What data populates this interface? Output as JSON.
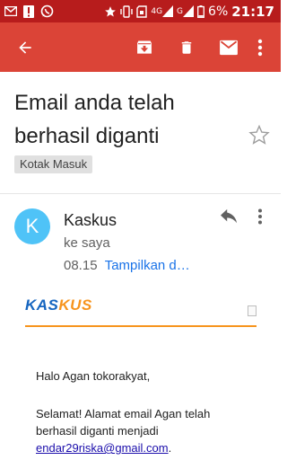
{
  "status_bar": {
    "network_label": "4G",
    "signal_label": "G",
    "battery_percent": "6%",
    "time": "21:17",
    "left_icons": [
      "gmail-icon",
      "alert-icon",
      "whatsapp-icon"
    ],
    "right_icons": [
      "star-icon",
      "vibrate-icon",
      "sim-icon",
      "signal-4g-icon",
      "signal-g-icon",
      "battery-icon"
    ]
  },
  "toolbar": {
    "color": "#db4437",
    "status_color": "#b71c1c",
    "icons": [
      "back-arrow-icon",
      "archive-icon",
      "delete-icon",
      "mark-unread-icon",
      "more-vert-icon"
    ]
  },
  "message": {
    "subject": "Email anda telah berhasil diganti",
    "label": "Kotak Masuk",
    "sender_initial": "K",
    "sender_name": "Kaskus",
    "recipient": "ke saya",
    "time": "08.15",
    "details_link": "Tampilkan d…",
    "avatar_color": "#4fc3f7"
  },
  "email_body": {
    "logo_part1": "KAS",
    "logo_part2": "KUS",
    "greeting": "Halo Agan tokorakyat,",
    "paragraph": "Selamat! Alamat email Agan telah berhasil diganti menjadi",
    "email_address": "endar29riska@gmail.com",
    "trailing_period": ".",
    "accent_color": "#f7941d",
    "link_color": "#1a0dab"
  }
}
